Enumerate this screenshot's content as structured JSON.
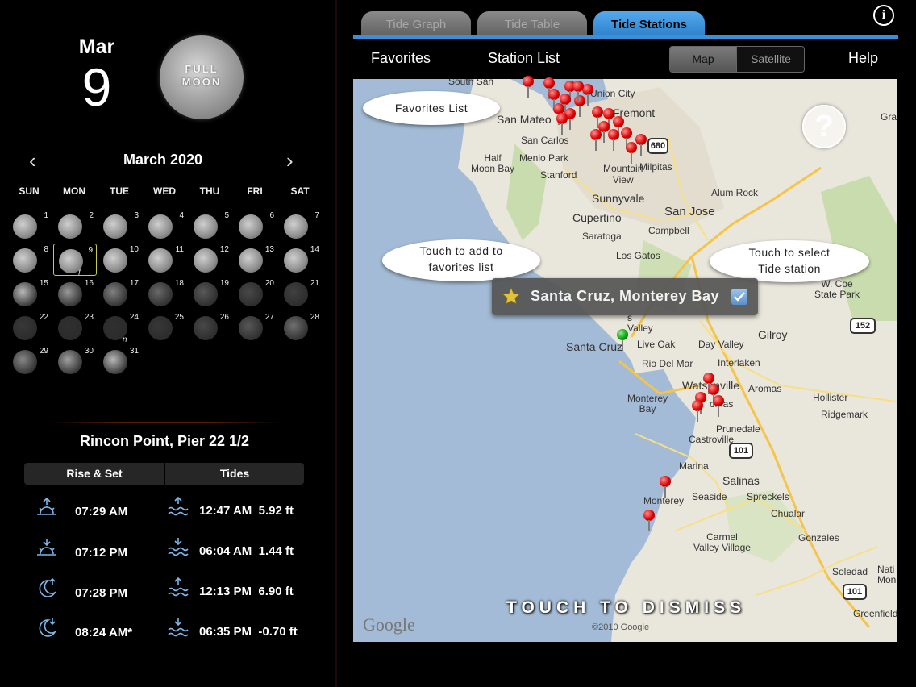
{
  "header": {
    "info_icon": "info-icon",
    "tabs": [
      {
        "label": "Tide Graph",
        "active": false
      },
      {
        "label": "Tide Table",
        "active": false
      },
      {
        "label": "Tide Stations",
        "active": true
      }
    ],
    "favorites_label": "Favorites",
    "station_list_label": "Station List",
    "help_label": "Help",
    "map_toggle": {
      "map": "Map",
      "satellite": "Satellite",
      "selected": "Map"
    }
  },
  "date_panel": {
    "month": "Mar",
    "day": "9",
    "moon_phase_line1": "FULL",
    "moon_phase_line2": "MOON"
  },
  "calendar": {
    "title": "March 2020",
    "prev_icon": "chevron-left-icon",
    "next_icon": "chevron-right-icon",
    "weekdays": [
      "SUN",
      "MON",
      "TUE",
      "WED",
      "THU",
      "FRI",
      "SAT"
    ],
    "days": [
      "1",
      "2",
      "3",
      "4",
      "5",
      "6",
      "7",
      "8",
      "9",
      "10",
      "11",
      "12",
      "13",
      "14",
      "15",
      "16",
      "17",
      "18",
      "19",
      "20",
      "21",
      "22",
      "23",
      "24",
      "25",
      "26",
      "27",
      "28",
      "29",
      "30",
      "31"
    ],
    "selected_day": "9",
    "markers": {
      "day9": "f",
      "day24": "n"
    }
  },
  "station": {
    "name": "Rincon Point, Pier 22 1/2",
    "rise_set_header": "Rise & Set",
    "tides_header": "Tides",
    "rise_set": [
      {
        "icon": "sunrise-icon",
        "time": "07:29 AM"
      },
      {
        "icon": "sunset-icon",
        "time": "07:12 PM"
      },
      {
        "icon": "moonrise-icon",
        "time": "07:28 PM"
      },
      {
        "icon": "moonset-icon",
        "time": "08:24 AM*"
      }
    ],
    "tides": [
      {
        "icon": "high-tide-icon",
        "time": "12:47 AM",
        "height": "5.92 ft"
      },
      {
        "icon": "low-tide-icon",
        "time": "06:04 AM",
        "height": "1.44 ft"
      },
      {
        "icon": "high-tide-icon",
        "time": "12:13 PM",
        "height": "6.90 ft"
      },
      {
        "icon": "low-tide-icon",
        "time": "06:35 PM",
        "height": "-0.70 ft"
      }
    ]
  },
  "map": {
    "labels": {
      "south_san": "South San",
      "union_city": "Union City",
      "fremont": "Fremont",
      "san_mateo": "San Mateo",
      "san_carlos": "San Carlos",
      "menlo_park": "Menlo Park",
      "half_moon_bay": "Half\nMoon Bay",
      "stanford": "Stanford",
      "mountain_view": "Mountain\nView",
      "milpitas": "Milpitas",
      "sunnyvale": "Sunnyvale",
      "alum_rock": "Alum Rock",
      "cupertino": "Cupertino",
      "san_jose": "San Jose",
      "saratoga": "Saratoga",
      "campbell": "Campbell",
      "los_gatos": "Los Gatos",
      "coe_state_park": "W. Coe\nState Park",
      "gilroy": "Gilroy",
      "scotts_valley": "s\nValley",
      "santa_cruz": "Santa Cruz",
      "live_oak": "Live Oak",
      "day_valley": "Day Valley",
      "rio_del_mar": "Rio Del Mar",
      "interlaken": "Interlaken",
      "watsonville": "Watsonville",
      "aromas": "Aromas",
      "hollister": "Hollister",
      "monterey_bay": "Monterey\nBay",
      "ridgemark": "Ridgemark",
      "prunedale": "Prunedale",
      "castroville": "Castroville",
      "marina": "Marina",
      "seaside": "Seaside",
      "salinas": "Salinas",
      "spreckels": "Spreckels",
      "monterey": "Monterey",
      "chualar": "Chualar",
      "carmel_valley_village": "Carmel\nValley Village",
      "gonzales": "Gonzales",
      "soledad": "Soledad",
      "greenfield": "Greenfield",
      "gray": "Gray",
      "nat": "Nati\nMonu",
      "thomas": "omas",
      "hwy_680": "680",
      "hwy_152": "152",
      "hwy_101a": "101",
      "hwy_101b": "101"
    },
    "favorites_bubble": "Favorites List",
    "add_bubble": "Touch to add to\nfavorites list",
    "select_bubble": "Touch to select\nTide station",
    "callout_station": "Santa Cruz, Monterey Bay",
    "callout_star_icon": "star-icon",
    "callout_checkbox_icon": "checkbox-icon",
    "help_icon": "question-icon",
    "help_symbol": "?",
    "dismiss": "TOUCH TO DISMISS",
    "google": "Google",
    "copyright": "©2010 Google"
  },
  "colors": {
    "accent_blue": "#2a7ec6",
    "pin_red": "#dd0000",
    "pin_green": "#12a012",
    "water": "#a3bbd6",
    "land": "#e9e6dc"
  }
}
